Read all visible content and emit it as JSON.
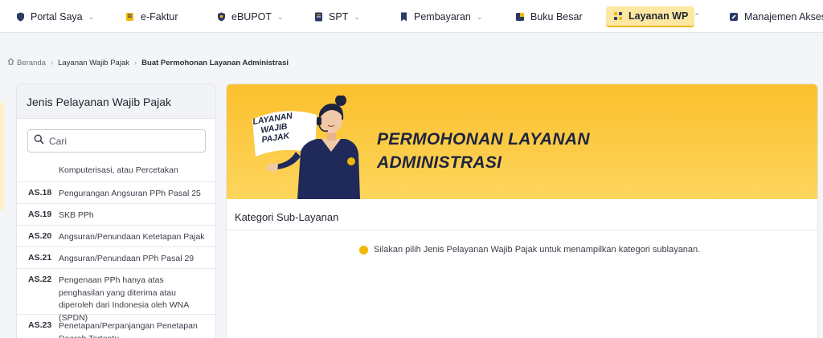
{
  "nav": {
    "items": [
      {
        "label": "Portal Saya",
        "icon": "shield-icon",
        "chevron": true
      },
      {
        "label": "e-Faktur",
        "icon": "receipt-icon",
        "chevron": false
      },
      {
        "label": "eBUPOT",
        "icon": "shield-icon",
        "chevron": true
      },
      {
        "label": "SPT",
        "icon": "document-icon",
        "chevron": true
      },
      {
        "label": "Pembayaran",
        "icon": "bookmark-icon",
        "chevron": true
      },
      {
        "label": "Buku Besar",
        "icon": "ledger-icon",
        "chevron": false
      },
      {
        "label": "Layanan WP",
        "icon": "grid-icon",
        "chevron": true,
        "active": true
      },
      {
        "label": "Manajemen Akses",
        "icon": "key-icon",
        "chevron": false
      }
    ]
  },
  "breadcrumb": {
    "home": "Beranda",
    "level1": "Layanan Wajib Pajak",
    "current": "Buat Permohonan Layanan Administrasi"
  },
  "sidebar": {
    "title": "Jenis Pelayanan Wajib Pajak",
    "search_placeholder": "Cari",
    "continued_text": "Komputerisasi, atau Percetakan",
    "items": [
      {
        "code": "AS.18",
        "name": "Pengurangan Angsuran PPh Pasal 25"
      },
      {
        "code": "AS.19",
        "name": "SKB PPh"
      },
      {
        "code": "AS.20",
        "name": "Angsuran/Penundaan Ketetapan Pajak"
      },
      {
        "code": "AS.21",
        "name": "Angsuran/Penundaan PPh Pasal 29"
      },
      {
        "code": "AS.22",
        "name": "Pengenaan PPh hanya atas penghasilan yang diterima atau diperoleh dari Indonesia oleh WNA (SPDN)"
      },
      {
        "code": "AS.23",
        "name": "Penetapan/Perpanjangan Penetapan Daerah Tertentu"
      }
    ]
  },
  "banner": {
    "title_line1": "PERMOHONAN LAYANAN",
    "title_line2": "ADMINISTRASI",
    "badge_line1": "LAYANAN",
    "badge_line2": "WAJIB",
    "badge_line3": "PAJAK"
  },
  "main": {
    "section_title": "Kategori Sub-Layanan",
    "info_message": "Silakan pilih Jenis Pelayanan Wajib Pajak untuk menampilkan kategori sublayanan."
  },
  "colors": {
    "accent": "#f2b705",
    "banner": "#fbc02d",
    "navy": "#1d2440"
  }
}
